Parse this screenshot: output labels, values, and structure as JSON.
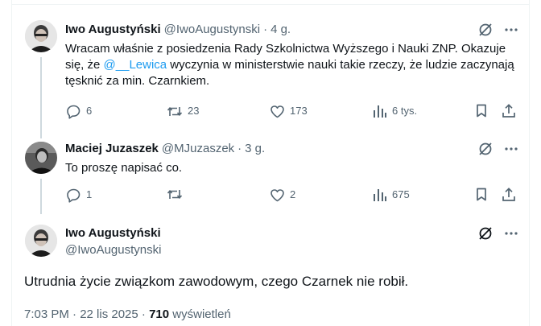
{
  "tweets": [
    {
      "name": "Iwo Augustyński",
      "handle": "@IwoAugustynski",
      "separator": "·",
      "time": "4 g.",
      "text_before": "Wracam właśnie z posiedzenia Rady Szkolnictwa Wyższego i Nauki ZNP. Okazuje się, że ",
      "mention": "@__Lewica",
      "text_after": " wyczynia w ministerstwie nauki takie rzeczy, że ludzie zaczynają tęsknić za min. Czarnkiem.",
      "replies": "6",
      "reposts": "23",
      "likes": "173",
      "views": "6 tys."
    },
    {
      "name": "Maciej Juzaszek",
      "handle": "@MJuzaszek",
      "separator": "·",
      "time": "3 g.",
      "text": "To proszę napisać co.",
      "replies": "1",
      "reposts": "",
      "likes": "2",
      "views": "675"
    }
  ],
  "main_tweet": {
    "name": "Iwo Augustyński",
    "handle": "@IwoAugustynski",
    "text": "Utrudnia życie związkom zawodowym, czego Czarnek nie robił.",
    "timestamp": "7:03 PM · 22 lis 2025 · ",
    "views_count": "710",
    "views_label": " wyświetleń"
  },
  "icons": {
    "grok": "grok-icon",
    "more": "more-icon",
    "reply": "reply-icon",
    "repost": "repost-icon",
    "like": "like-icon",
    "views": "views-icon",
    "bookmark": "bookmark-icon",
    "share": "share-icon"
  },
  "colors": {
    "text": "#0f1419",
    "secondary": "#536471",
    "accent": "#1d9bf0",
    "border": "#eff3f4"
  }
}
